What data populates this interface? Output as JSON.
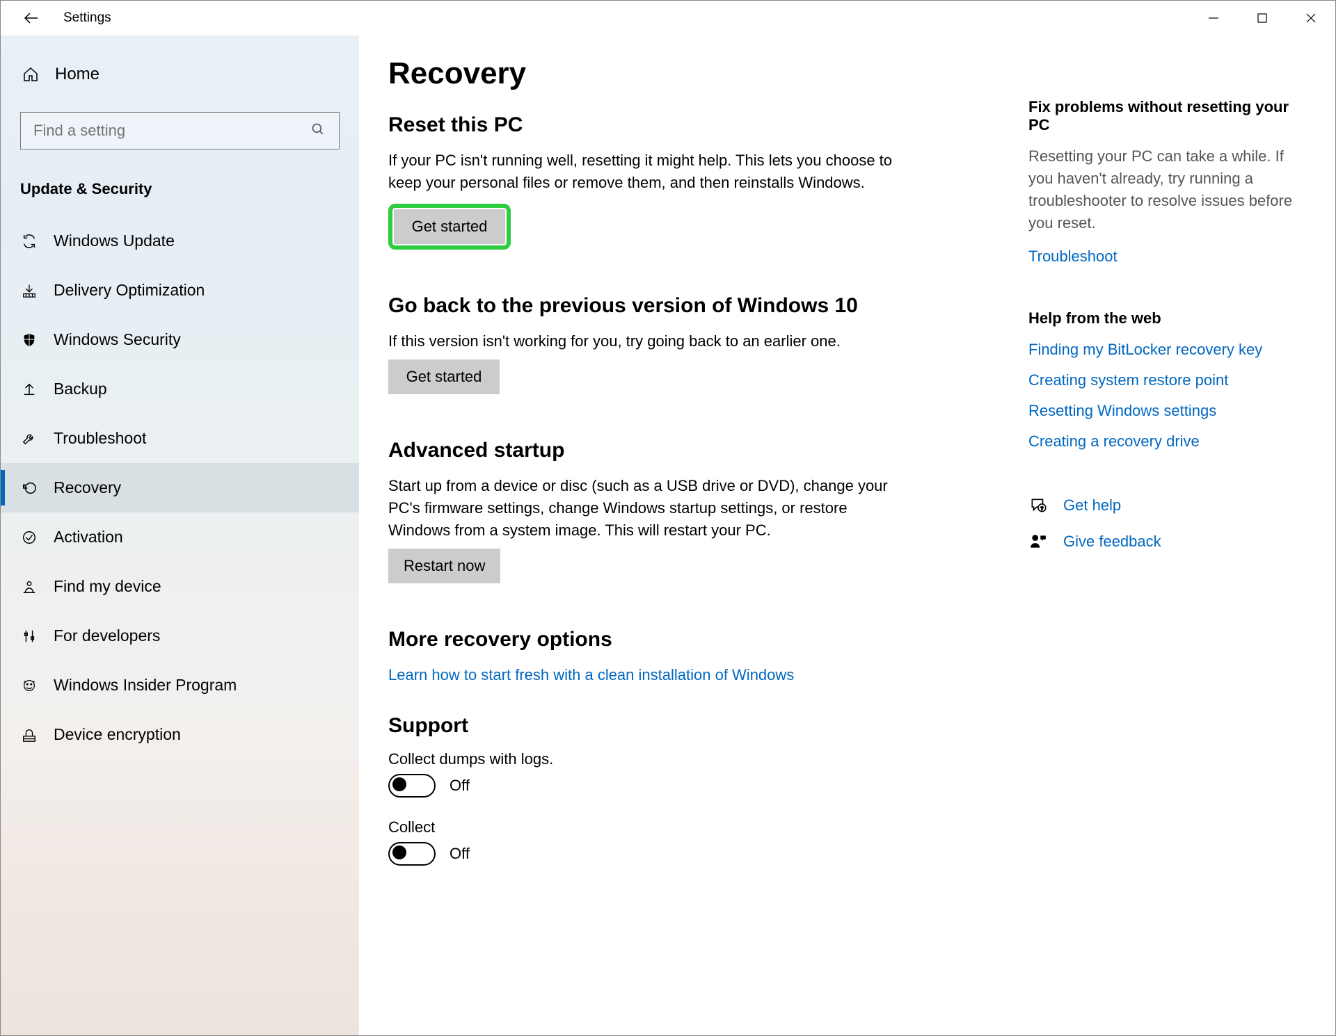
{
  "window": {
    "title": "Settings"
  },
  "sidebar": {
    "home_label": "Home",
    "search_placeholder": "Find a setting",
    "section_title": "Update & Security",
    "items": [
      {
        "label": "Windows Update",
        "icon": "sync-icon"
      },
      {
        "label": "Delivery Optimization",
        "icon": "delivery-icon"
      },
      {
        "label": "Windows Security",
        "icon": "shield-icon"
      },
      {
        "label": "Backup",
        "icon": "backup-icon"
      },
      {
        "label": "Troubleshoot",
        "icon": "wrench-icon"
      },
      {
        "label": "Recovery",
        "icon": "recovery-icon"
      },
      {
        "label": "Activation",
        "icon": "check-circle-icon"
      },
      {
        "label": "Find my device",
        "icon": "find-device-icon"
      },
      {
        "label": "For developers",
        "icon": "developer-icon"
      },
      {
        "label": "Windows Insider Program",
        "icon": "insider-icon"
      },
      {
        "label": "Device encryption",
        "icon": "encryption-icon"
      }
    ],
    "active_index": 5
  },
  "page": {
    "title": "Recovery",
    "sections": {
      "reset": {
        "title": "Reset this PC",
        "desc": "If your PC isn't running well, resetting it might help. This lets you choose to keep your personal files or remove them, and then reinstalls Windows.",
        "button": "Get started",
        "highlighted": true
      },
      "goback": {
        "title": "Go back to the previous version of Windows 10",
        "desc": "If this version isn't working for you, try going back to an earlier one.",
        "button": "Get started"
      },
      "advanced": {
        "title": "Advanced startup",
        "desc": "Start up from a device or disc (such as a USB drive or DVD), change your PC's firmware settings, change Windows startup settings, or restore Windows from a system image. This will restart your PC.",
        "button": "Restart now"
      },
      "more": {
        "title": "More recovery options",
        "link": "Learn how to start fresh with a clean installation of Windows"
      },
      "support": {
        "title": "Support",
        "dumps_label": "Collect dumps with logs.",
        "dumps_state": "Off",
        "collect_label": "Collect",
        "collect_state": "Off"
      }
    }
  },
  "side": {
    "fix": {
      "title": "Fix problems without resetting your PC",
      "desc": "Resetting your PC can take a while. If you haven't already, try running a troubleshooter to resolve issues before you reset.",
      "link": "Troubleshoot"
    },
    "web": {
      "title": "Help from the web",
      "links": [
        "Finding my BitLocker recovery key",
        "Creating system restore point",
        "Resetting Windows settings",
        "Creating a recovery drive"
      ]
    },
    "actions": {
      "get_help": "Get help",
      "give_feedback": "Give feedback"
    }
  }
}
